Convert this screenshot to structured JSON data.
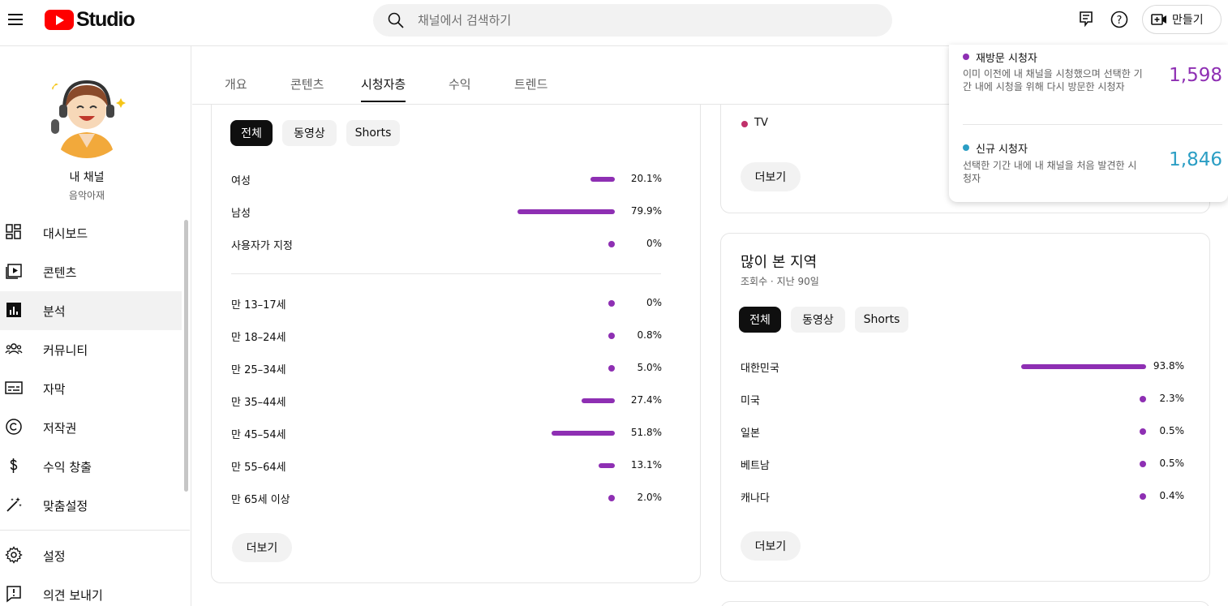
{
  "topbar": {
    "logo_text": "Studio",
    "search_placeholder": "채널에서 검색하기",
    "create_label": "만들기"
  },
  "sidebar": {
    "channel_name": "내 채널",
    "channel_handle": "음악아재",
    "items": [
      {
        "label": "대시보드",
        "icon": "dashboard-icon"
      },
      {
        "label": "콘텐츠",
        "icon": "content-icon"
      },
      {
        "label": "분석",
        "icon": "analytics-icon",
        "active": true
      },
      {
        "label": "커뮤니티",
        "icon": "community-icon"
      },
      {
        "label": "자막",
        "icon": "subtitles-icon"
      },
      {
        "label": "저작권",
        "icon": "copyright-icon"
      },
      {
        "label": "수익 창출",
        "icon": "monetization-icon"
      },
      {
        "label": "맞춤설정",
        "icon": "customization-icon"
      }
    ],
    "bottom_items": [
      {
        "label": "설정",
        "icon": "gear-icon"
      },
      {
        "label": "의견 보내기",
        "icon": "feedback-icon"
      }
    ]
  },
  "tabs": [
    "개요",
    "콘텐츠",
    "시청자층",
    "수익",
    "트렌드"
  ],
  "active_tab": "시청자층",
  "demographics": {
    "chips": [
      "전체",
      "동영상",
      "Shorts"
    ],
    "gender": [
      {
        "label": "여성",
        "value": "20.1%",
        "pct": 20.1
      },
      {
        "label": "남성",
        "value": "79.9%",
        "pct": 79.9
      },
      {
        "label": "사용자가 지정",
        "value": "0%",
        "pct": 0
      }
    ],
    "age": [
      {
        "label": "만 13–17세",
        "value": "0%",
        "pct": 0
      },
      {
        "label": "만 18–24세",
        "value": "0.8%",
        "pct": 0.8
      },
      {
        "label": "만 25–34세",
        "value": "5.0%",
        "pct": 5.0
      },
      {
        "label": "만 35–44세",
        "value": "27.4%",
        "pct": 27.4
      },
      {
        "label": "만 45–54세",
        "value": "51.8%",
        "pct": 51.8
      },
      {
        "label": "만 55–64세",
        "value": "13.1%",
        "pct": 13.1
      },
      {
        "label": "만 65세 이상",
        "value": "2.0%",
        "pct": 2.0
      }
    ],
    "more_label": "더보기"
  },
  "device_card": {
    "tv_label": "TV",
    "more_label": "더보기"
  },
  "geo": {
    "title": "많이 본 지역",
    "subtitle": "조회수 · 지난 90일",
    "chips": [
      "전체",
      "동영상",
      "Shorts"
    ],
    "rows": [
      {
        "label": "대한민국",
        "value": "93.8%",
        "pct": 93.8
      },
      {
        "label": "미국",
        "value": "2.3%",
        "pct": 2.3
      },
      {
        "label": "일본",
        "value": "0.5%",
        "pct": 0.5
      },
      {
        "label": "베트남",
        "value": "0.5%",
        "pct": 0.5
      },
      {
        "label": "캐나다",
        "value": "0.4%",
        "pct": 0.4
      }
    ],
    "more_label": "더보기"
  },
  "viewer_popup": {
    "returning": {
      "title": "재방문 시청자",
      "desc": "이미 이전에 내 채널을 시청했으며 선택한 기간 내에 시청을 위해 다시 방문한 시청자",
      "value": "1,598",
      "color": "#8e2fb3"
    },
    "new": {
      "title": "신규 시청자",
      "desc": "선택한 기간 내에 내 채널을 처음 발견한 시청자",
      "value": "1,846",
      "color": "#2b9ec4"
    }
  },
  "colors": {
    "bar": "#8e2fb3",
    "accent_blue": "#2b9ec4"
  }
}
